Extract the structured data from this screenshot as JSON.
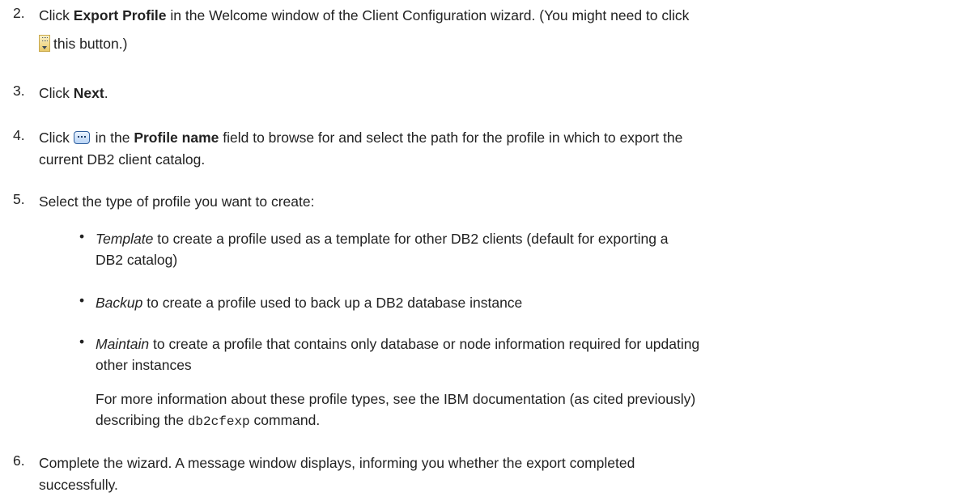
{
  "steps": [
    {
      "num": "2.",
      "prefix": "Click ",
      "bold": "Export Profile",
      "text": " in the Welcome window of the Client Configuration wizard. (You might need to click",
      "line2": "this button.)"
    },
    {
      "num": "3.",
      "prefix": "Click ",
      "bold": "Next",
      "suffix": "."
    },
    {
      "num": "4.",
      "prefix": "Click ",
      "middle": " in the ",
      "bold": "Profile name",
      "text": " field to browse for and select the path for the profile in which to export the",
      "line2": "current DB2 client catalog."
    },
    {
      "num": "5.",
      "text": "Select the type of profile you want to create:",
      "bullets": [
        {
          "italic": "Template",
          "text": " to create a profile used as a template for other DB2 clients (default for exporting a",
          "line2": "DB2 catalog)"
        },
        {
          "italic": "Backup",
          "text": " to create a profile used to back up a DB2 database instance"
        },
        {
          "italic": "Maintain",
          "text": " to create a profile that contains only database or node information required for updating",
          "line2": "other instances"
        }
      ],
      "note_line1": "For more information about these profile types, see the IBM documentation (as cited previously)",
      "note_prefix": "describing the ",
      "note_code": "db2cfexp",
      "note_suffix": " command."
    },
    {
      "num": "6.",
      "text": "Complete the wizard. A message window displays, informing you whether the export completed",
      "line2": "successfully."
    }
  ],
  "icons": {
    "expand": "expand-toolbar-icon",
    "browse": "ellipsis-browse-icon"
  }
}
